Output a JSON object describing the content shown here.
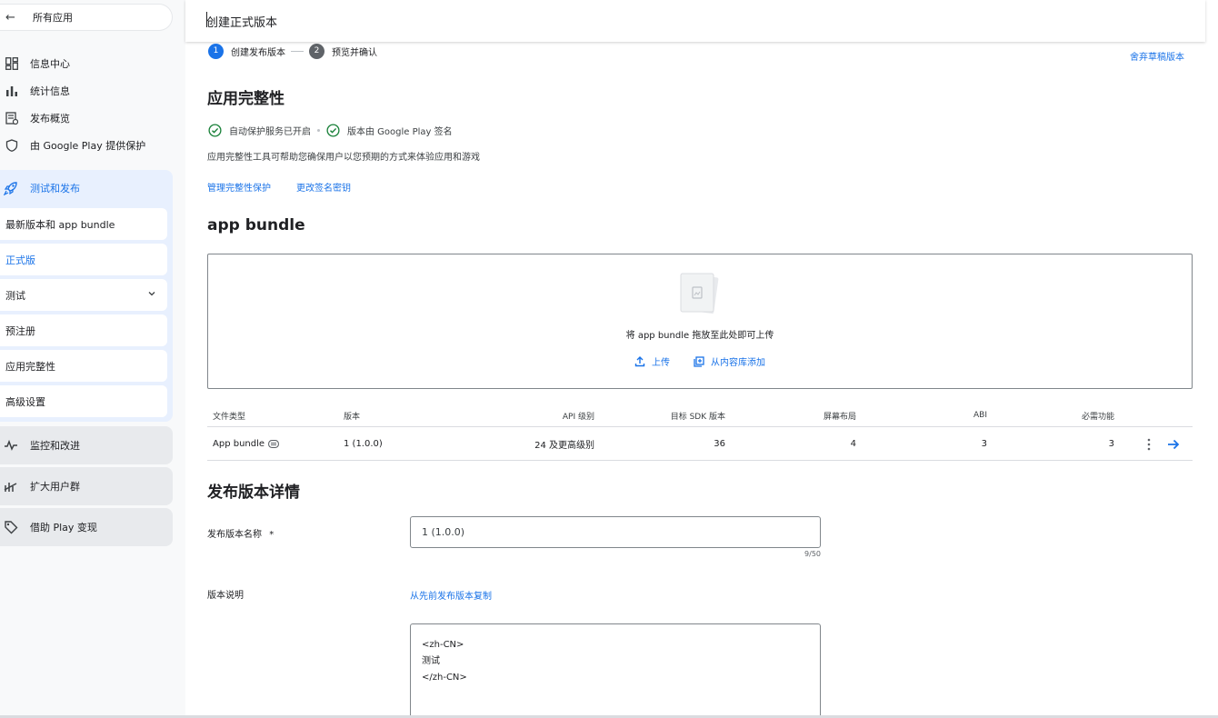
{
  "sidebar": {
    "back_label": "所有应用",
    "items": [
      {
        "label": "信息中心",
        "icon": "dashboard-icon"
      },
      {
        "label": "统计信息",
        "icon": "bar-chart-icon"
      },
      {
        "label": "发布概览",
        "icon": "release-overview-icon"
      },
      {
        "label": "由 Google Play 提供保护",
        "icon": "shield-icon"
      }
    ],
    "test_publish": {
      "label": "测试和发布",
      "icon": "rocket-icon",
      "subitems": [
        {
          "label": "最新版本和 app bundle"
        },
        {
          "label": "正式版",
          "active": true
        },
        {
          "label": "测试",
          "chevron": "chevron-down-icon"
        },
        {
          "label": "预注册"
        },
        {
          "label": "应用完整性"
        },
        {
          "label": "高级设置"
        }
      ]
    },
    "groups": [
      {
        "label": "监控和改进",
        "icon": "pulse-icon"
      },
      {
        "label": "扩大用户群",
        "icon": "grow-icon"
      },
      {
        "label": "借助 Play 变现",
        "icon": "tag-icon"
      }
    ]
  },
  "header": {
    "title": "创建正式版本"
  },
  "stepper": {
    "steps": [
      {
        "num": "1",
        "label": "创建发布版本"
      },
      {
        "num": "2",
        "label": "预览并确认"
      }
    ]
  },
  "discard_label": "舍弃草稿版本",
  "integrity": {
    "title": "应用完整性",
    "check1": "自动保护服务已开启",
    "check2": "版本由 Google Play 签名",
    "description": "应用完整性工具可帮助您确保用户以您预期的方式来体验应用和游戏",
    "link_manage": "管理完整性保护",
    "link_change_key": "更改签名密钥"
  },
  "bundle": {
    "title": "app bundle",
    "drop_text": "将 app bundle 拖放至此处即可上传",
    "upload_label": "上传",
    "library_label": "从内容库添加",
    "table": {
      "headers": {
        "type": "文件类型",
        "version": "版本",
        "api": "API 级别",
        "sdk": "目标 SDK 版本",
        "screen": "屏幕布局",
        "abi": "ABI",
        "features": "必需功能"
      },
      "row": {
        "type": "App bundle",
        "version": "1 (1.0.0)",
        "api": "24 及更高级别",
        "sdk": "36",
        "screen": "4",
        "abi": "3",
        "features": "3"
      }
    }
  },
  "details": {
    "title": "发布版本详情",
    "name_label": "发布版本名称",
    "required_mark": "*",
    "name_value": "1 (1.0.0)",
    "name_counter": "9/50",
    "notes_label": "版本说明",
    "copy_label": "从先前发布版本复制",
    "notes_value": "<zh-CN>\n测试\n</zh-CN>"
  },
  "colors": {
    "accent": "#1a73e8",
    "check": "#188038",
    "sidebar_bg": "#f8f9fa",
    "group_active_bg": "#e8f0fe"
  }
}
